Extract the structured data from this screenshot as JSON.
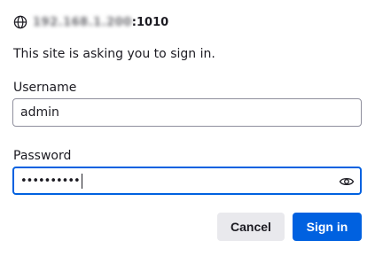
{
  "dialog": {
    "origin": {
      "host_obscured": "192.168.1.200",
      "port": ":1010",
      "icon": "globe-icon"
    },
    "message": "This site is asking you to sign in.",
    "username": {
      "label": "Username",
      "value": "admin"
    },
    "password": {
      "label": "Password",
      "masked_value": "••••••••••",
      "reveal_icon": "eye-icon"
    },
    "buttons": {
      "cancel": "Cancel",
      "sign_in": "Sign in"
    }
  },
  "colors": {
    "accent": "#0061e0",
    "button_secondary": "#e9e9ed",
    "text": "#1c1b22"
  }
}
